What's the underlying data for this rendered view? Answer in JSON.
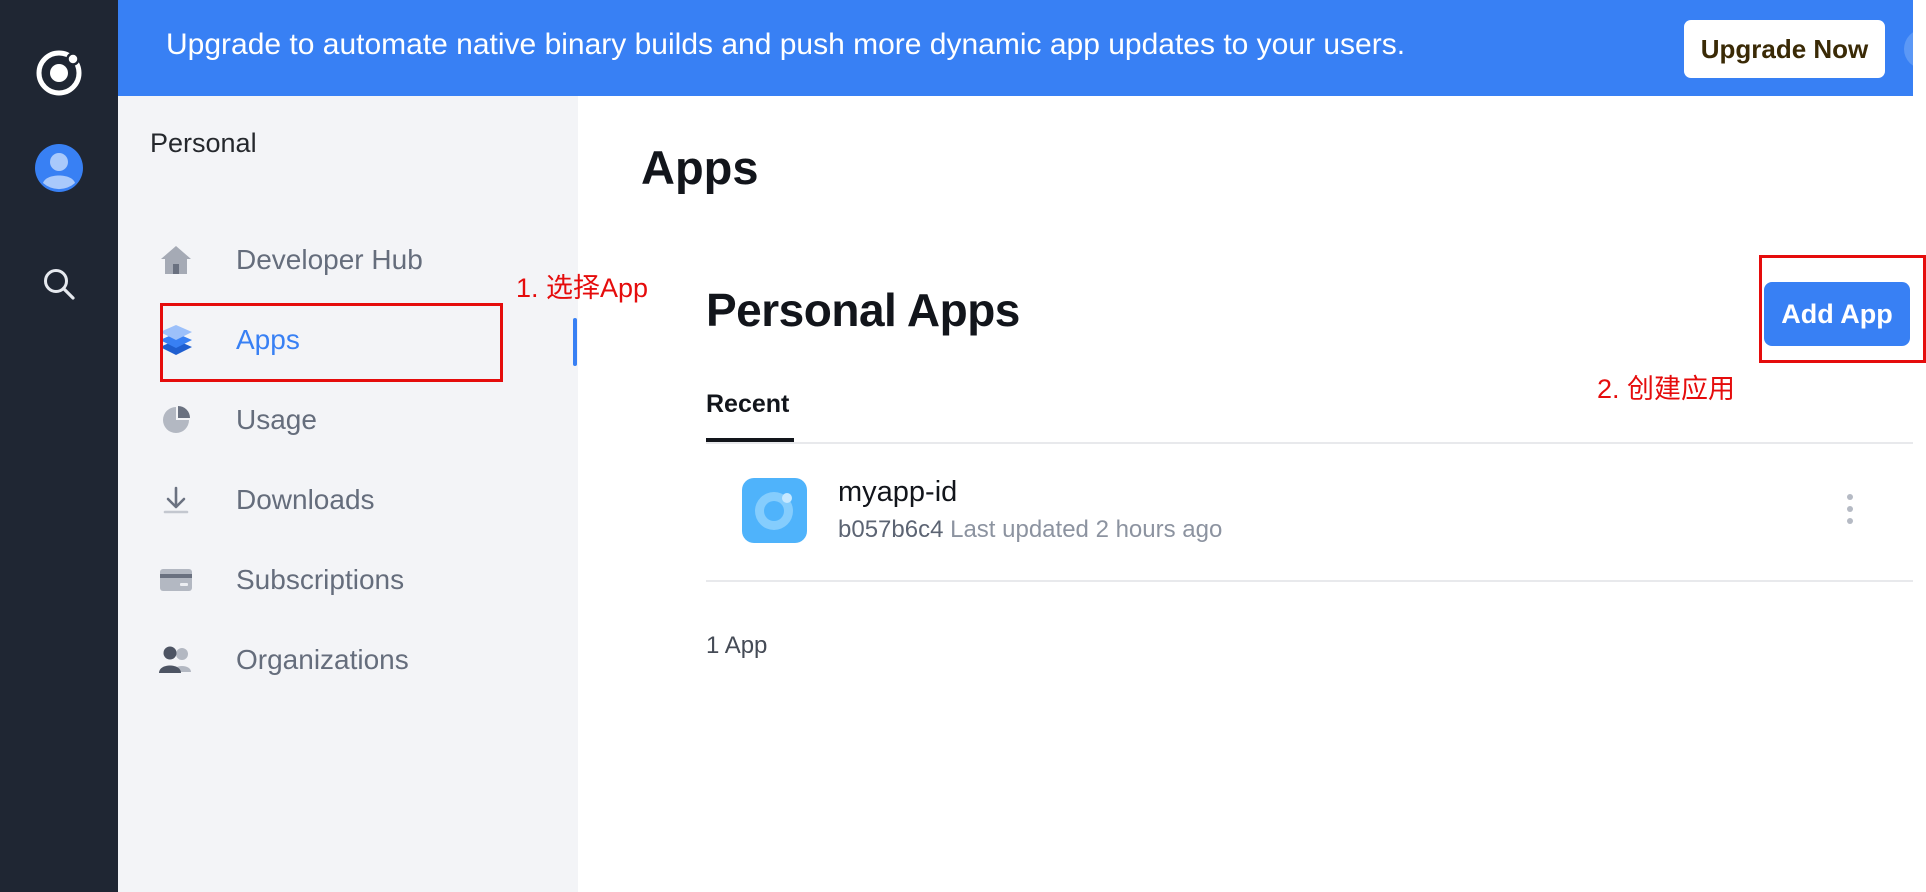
{
  "colors": {
    "rail_bg": "#1f2633",
    "banner_bg": "#3880f4",
    "accent": "#3880f4",
    "sidebar_bg": "#f3f4f7",
    "annotation_red": "#e50c0c"
  },
  "rail": {
    "icons": [
      "ionic-logo-icon",
      "user-avatar-icon",
      "search-icon"
    ]
  },
  "banner": {
    "message": "Upgrade to automate native binary builds and push more dynamic app updates to your users.",
    "upgrade_label": "Upgrade Now",
    "close_icon": "close-icon"
  },
  "sidebar": {
    "heading": "Personal",
    "items": [
      {
        "label": "Developer Hub",
        "icon": "home-icon"
      },
      {
        "label": "Apps",
        "icon": "layers-icon",
        "active": true
      },
      {
        "label": "Usage",
        "icon": "pie-chart-icon"
      },
      {
        "label": "Downloads",
        "icon": "download-icon"
      },
      {
        "label": "Subscriptions",
        "icon": "credit-card-icon"
      },
      {
        "label": "Organizations",
        "icon": "people-icon"
      }
    ]
  },
  "main": {
    "title": "Apps",
    "section_title": "Personal Apps",
    "add_label": "Add App",
    "tabs": [
      {
        "label": "Recent",
        "active": true
      }
    ],
    "apps": [
      {
        "name": "myapp-id",
        "hash": "b057b6c4",
        "updated": "Last updated 2 hours ago",
        "icon": "app-icon"
      }
    ],
    "count": "1 App"
  },
  "annotations": {
    "step1": "1. 选择App",
    "step2": "2. 创建应用"
  }
}
